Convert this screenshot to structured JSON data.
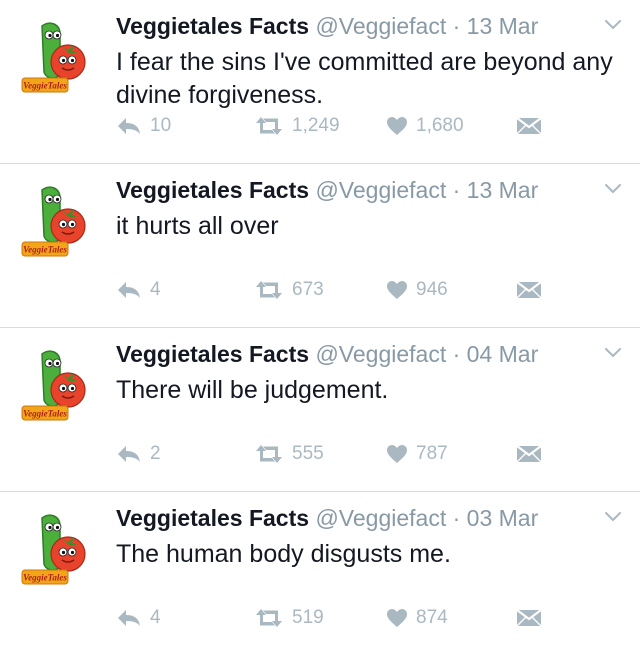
{
  "tweets": [
    {
      "author": "Veggietales Facts",
      "handle": "@Veggiefact",
      "separator": "·",
      "date": "13 Mar",
      "text": "I fear the sins I've committed are beyond any divine forgiveness.",
      "replies": "10",
      "retweets": "1,249",
      "likes": "1,680",
      "avatar_caption": "VeggieTales"
    },
    {
      "author": "Veggietales Facts",
      "handle": "@Veggiefact",
      "separator": "·",
      "date": "13 Mar",
      "text": "it hurts all over",
      "replies": "4",
      "retweets": "673",
      "likes": "946",
      "avatar_caption": "VeggieTales"
    },
    {
      "author": "Veggietales Facts",
      "handle": "@Veggiefact",
      "separator": "·",
      "date": "04 Mar",
      "text": "There will be judgement.",
      "replies": "2",
      "retweets": "555",
      "likes": "787",
      "avatar_caption": "VeggieTales"
    },
    {
      "author": "Veggietales Facts",
      "handle": "@Veggiefact",
      "separator": "·",
      "date": "03 Mar",
      "text": "The human body disgusts me.",
      "replies": "4",
      "retweets": "519",
      "likes": "874",
      "avatar_caption": "VeggieTales"
    }
  ],
  "icons": {
    "reply": "reply-icon",
    "retweet": "retweet-icon",
    "like": "heart-icon",
    "dm": "direct-message-icon",
    "menu": "chevron-down-icon"
  },
  "colors": {
    "text": "#141823",
    "muted": "#8899a6",
    "action": "#aab8c2",
    "divider": "#d9dde1",
    "cucumber": "#4caf3c",
    "tomato": "#e8442c",
    "logo": "#f3a51a"
  }
}
